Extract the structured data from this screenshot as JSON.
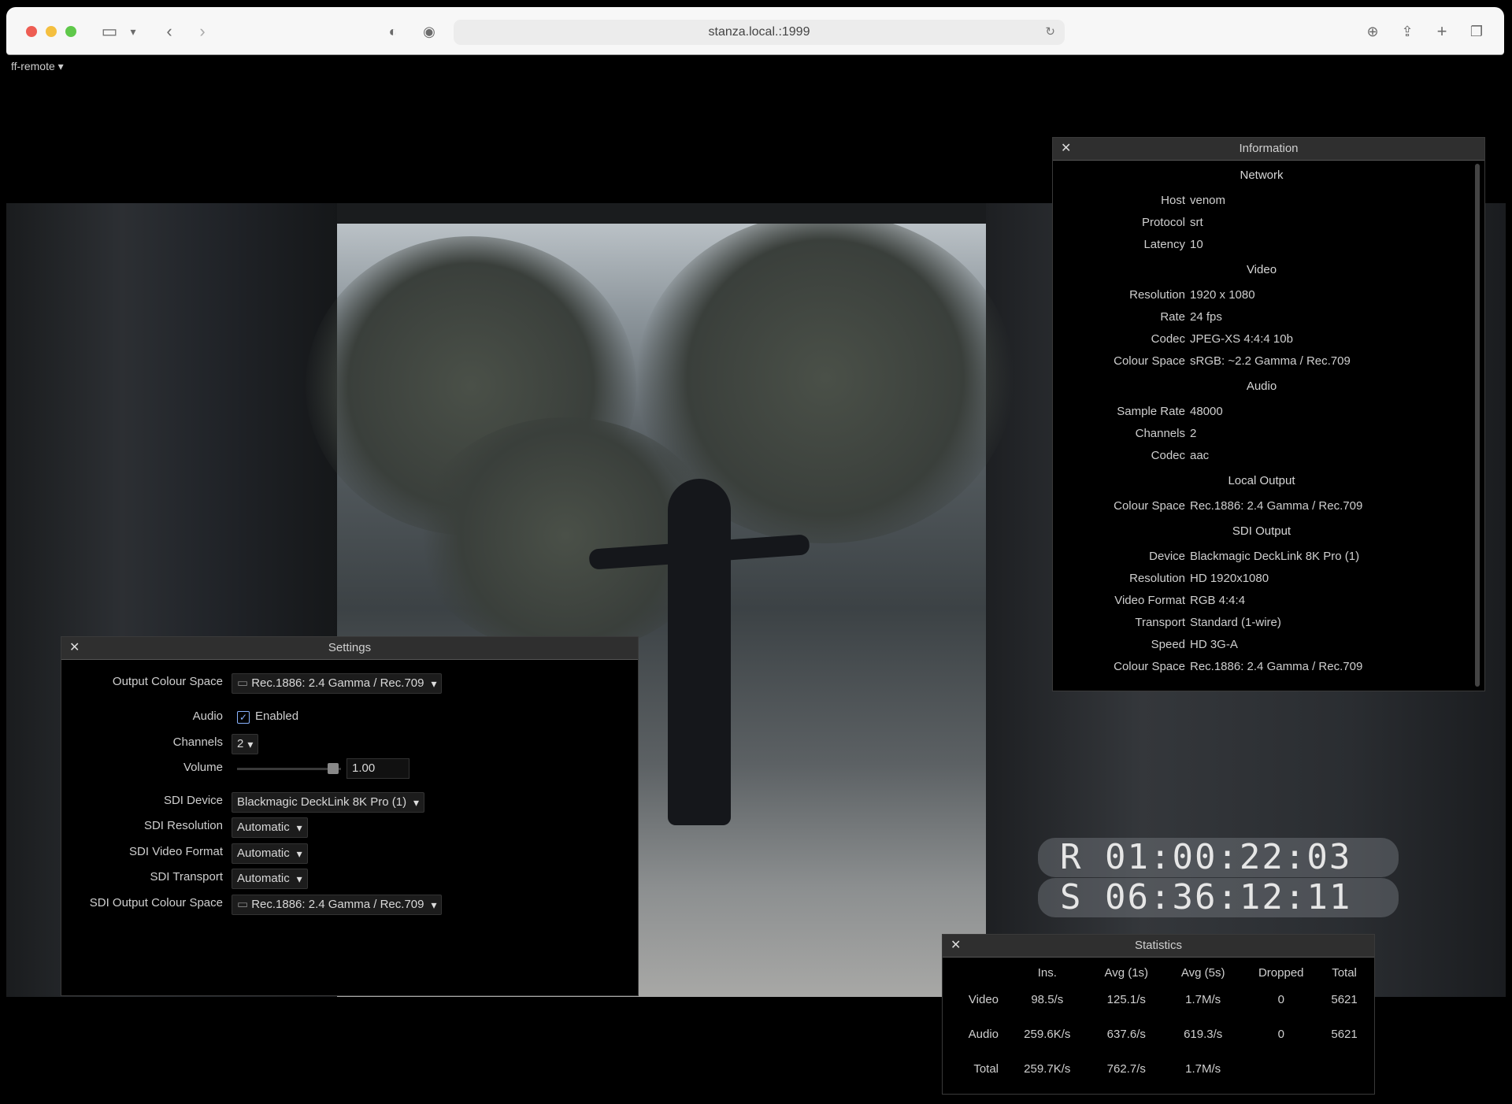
{
  "browser": {
    "url": "stanza.local.:1999",
    "icons": [
      "sidebar-icon",
      "chevron-down-icon",
      "back-arrow-icon",
      "forward-arrow-icon",
      "shield-icon",
      "privacy-report-icon",
      "reload-icon",
      "download-icon",
      "share-icon",
      "plus-icon",
      "tabs-overview-icon"
    ]
  },
  "menu": {
    "label": "ff-remote ▾"
  },
  "information": {
    "title": "Information",
    "sections": [
      {
        "heading": "Network",
        "rows": [
          {
            "k": "Host",
            "v": "venom"
          },
          {
            "k": "Protocol",
            "v": "srt"
          },
          {
            "k": "Latency",
            "v": "10"
          }
        ]
      },
      {
        "heading": "Video",
        "rows": [
          {
            "k": "Resolution",
            "v": "1920 x 1080"
          },
          {
            "k": "Rate",
            "v": "24 fps"
          },
          {
            "k": "Codec",
            "v": "JPEG-XS 4:4:4 10b"
          },
          {
            "k": "Colour Space",
            "v": "sRGB: ~2.2 Gamma / Rec.709"
          }
        ]
      },
      {
        "heading": "Audio",
        "rows": [
          {
            "k": "Sample Rate",
            "v": "48000"
          },
          {
            "k": "Channels",
            "v": "2"
          },
          {
            "k": "Codec",
            "v": "aac"
          }
        ]
      },
      {
        "heading": "Local Output",
        "rows": [
          {
            "k": "Colour Space",
            "v": "Rec.1886: 2.4 Gamma / Rec.709"
          }
        ]
      },
      {
        "heading": "SDI Output",
        "rows": [
          {
            "k": "Device",
            "v": "Blackmagic DeckLink 8K Pro (1)"
          },
          {
            "k": "Resolution",
            "v": "HD 1920x1080"
          },
          {
            "k": "Video Format",
            "v": "RGB 4:4:4"
          },
          {
            "k": "Transport",
            "v": "Standard (1-wire)"
          },
          {
            "k": "Speed",
            "v": "HD 3G-A"
          },
          {
            "k": "Colour Space",
            "v": "Rec.1886: 2.4 Gamma / Rec.709"
          }
        ]
      }
    ]
  },
  "settings": {
    "title": "Settings",
    "output_colour_space_label": "Output Colour Space",
    "output_colour_space_value": "Rec.1886: 2.4 Gamma / Rec.709",
    "audio_label": "Audio",
    "audio_enabled_label": "Enabled",
    "audio_enabled": true,
    "channels_label": "Channels",
    "channels_value": "2",
    "volume_label": "Volume",
    "volume_value": "1.00",
    "sdi_device_label": "SDI Device",
    "sdi_device_value": "Blackmagic DeckLink 8K Pro (1)",
    "sdi_resolution_label": "SDI Resolution",
    "sdi_resolution_value": "Automatic",
    "sdi_video_format_label": "SDI Video Format",
    "sdi_video_format_value": "Automatic",
    "sdi_transport_label": "SDI Transport",
    "sdi_transport_value": "Automatic",
    "sdi_output_colour_space_label": "SDI Output Colour Space",
    "sdi_output_colour_space_value": "Rec.1886: 2.4 Gamma / Rec.709"
  },
  "timecode": {
    "r": "R 01:00:22:03",
    "s": "S 06:36:12:11"
  },
  "statistics": {
    "title": "Statistics",
    "columns": [
      "",
      "Ins.",
      "Avg (1s)",
      "Avg (5s)",
      "Dropped",
      "Total"
    ],
    "rows": [
      [
        "Video",
        "98.5/s",
        "125.1/s",
        "1.7M/s",
        "0",
        "5621"
      ],
      [
        "Audio",
        "259.6K/s",
        "637.6/s",
        "619.3/s",
        "0",
        "5621"
      ],
      [
        "Total",
        "259.7K/s",
        "762.7/s",
        "1.7M/s",
        "",
        ""
      ]
    ]
  }
}
